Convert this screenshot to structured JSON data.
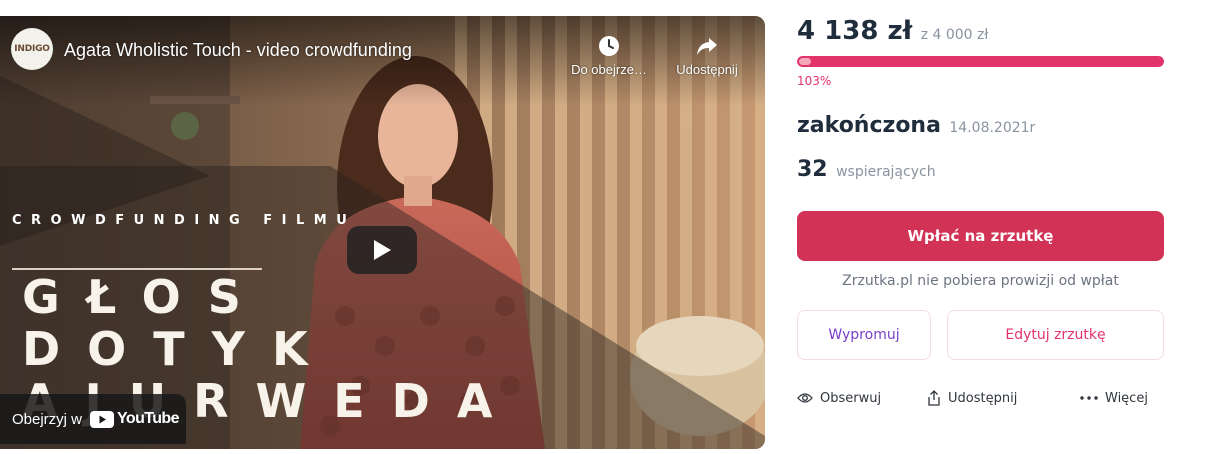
{
  "video": {
    "channel_avatar_text": "INDIGO",
    "title": "Agata Wholistic Touch - video crowdfunding",
    "watch_later_label": "Do obejrze…",
    "share_label": "Udostępnij",
    "overlay_small_text": "CROWDFUNDING FILMU",
    "overlay_words": [
      "GŁOS",
      "DOTYK",
      "AJURWEDA"
    ],
    "watch_on_label": "Obejrzyj w",
    "youtube_label": "YouTube"
  },
  "campaign": {
    "raised": "4 138 zł",
    "goal": "z 4 000 zł",
    "percent_label": "103%",
    "progress_fraction": 1.0,
    "status": "zakończona",
    "end_date": "14.08.2021r",
    "backers_count": "32",
    "backers_label": "wspierających",
    "donate_label": "Wpłać na zrzutkę",
    "no_fee_note": "Zrzutka.pl nie pobiera prowizji od wpłat",
    "promote_label": "Wypromuj",
    "edit_label": "Edytuj zrzutkę",
    "follow_label": "Obserwuj",
    "share_label": "Udostępnij",
    "more_label": "Więcej"
  },
  "colors": {
    "accent": "#e2336b",
    "donate_button": "#d13255",
    "promote_text": "#7a3fc9",
    "heading_text": "#1f2d3d"
  },
  "icons": {
    "watch_later": "clock-icon",
    "share_video": "share-arrow-icon",
    "play": "play-icon",
    "youtube": "youtube-logo-icon",
    "follow": "eye-icon",
    "share": "share-upload-icon",
    "more": "ellipsis-icon"
  }
}
